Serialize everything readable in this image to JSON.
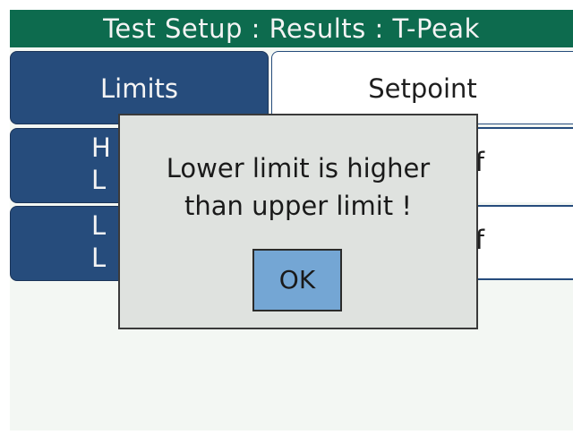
{
  "title": "Test Setup : Results : T-Peak",
  "tabs": [
    {
      "label": "Limits",
      "selected": true
    },
    {
      "label": "Setpoint",
      "selected": false
    }
  ],
  "rows": [
    {
      "label_line1": "H",
      "label_line2": "L",
      "value_fragment": "of"
    },
    {
      "label_line1": "L",
      "label_line2": "L",
      "value_fragment": "of"
    }
  ],
  "dialog": {
    "message_line1": "Lower limit is higher",
    "message_line2": "than upper limit !",
    "ok_label": "OK"
  },
  "colors": {
    "title_bar": "#0d6b4e",
    "button_blue": "#264c7c",
    "ok_button": "#74a6d4",
    "dialog_bg": "#dfe2df"
  }
}
